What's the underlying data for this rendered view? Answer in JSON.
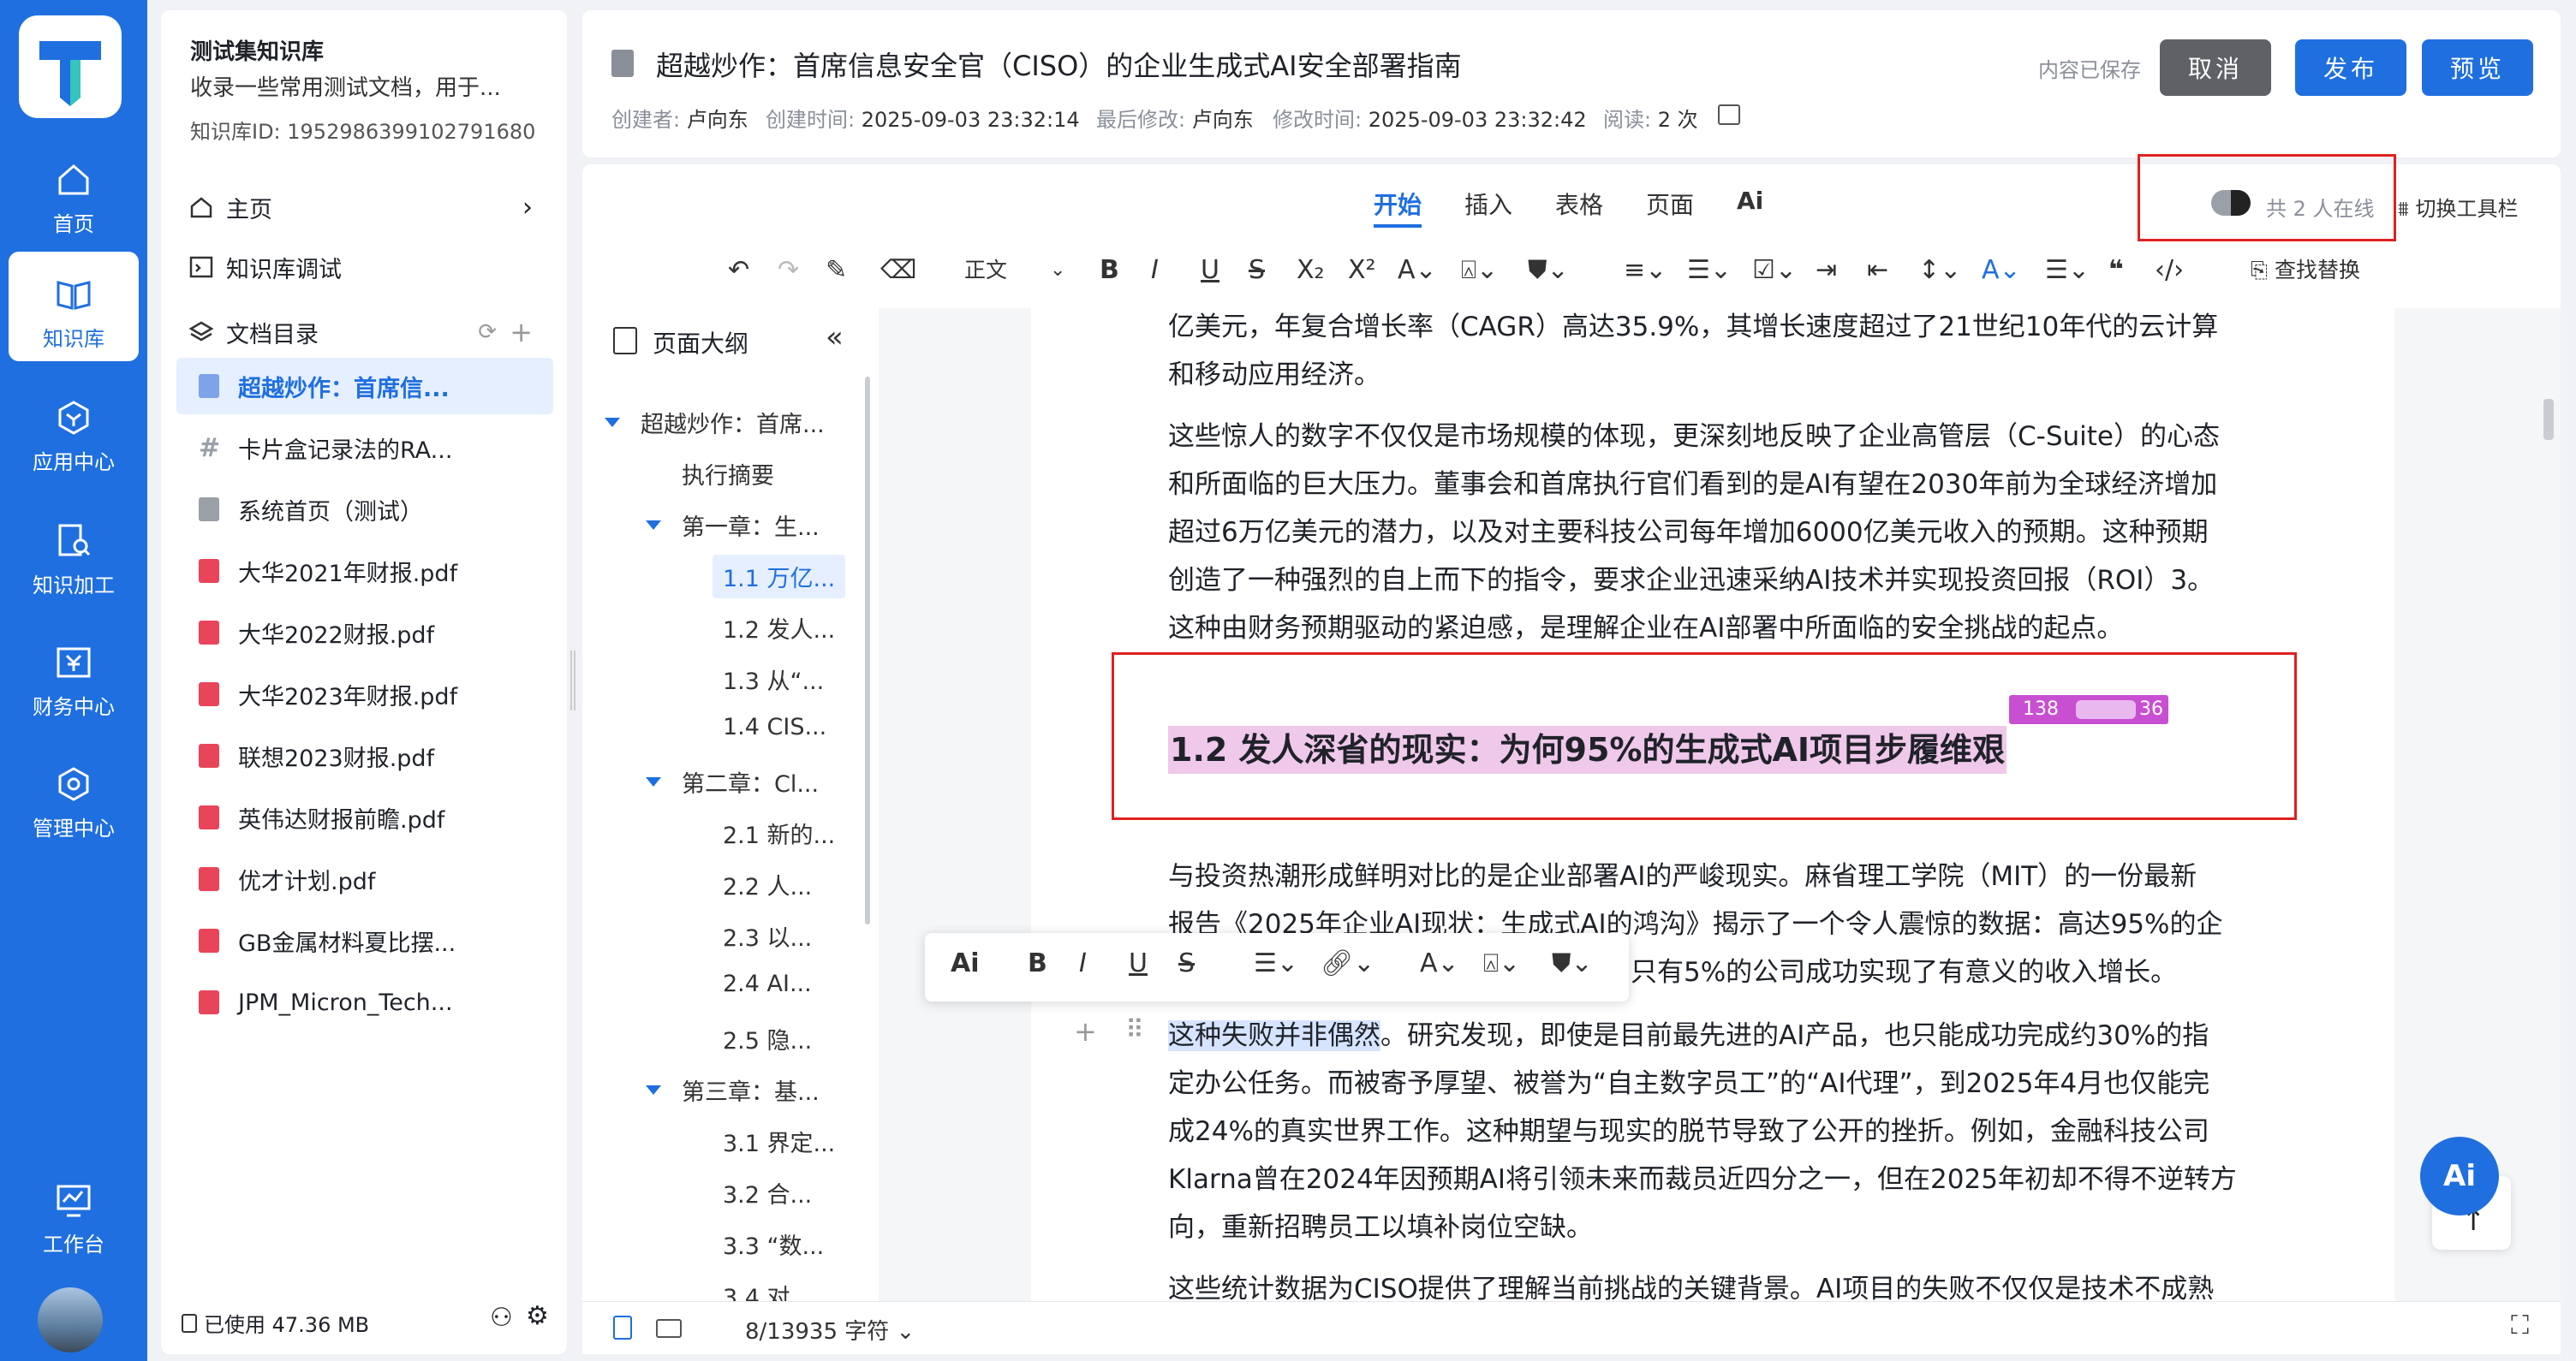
{
  "nav": {
    "items": [
      {
        "label": "首页",
        "icon": "home-icon"
      },
      {
        "label": "知识库",
        "icon": "book-icon"
      },
      {
        "label": "应用中心",
        "icon": "hexagon-icon"
      },
      {
        "label": "知识加工",
        "icon": "doc-search-icon"
      },
      {
        "label": "财务中心",
        "icon": "finance-icon"
      },
      {
        "label": "管理中心",
        "icon": "settings-hex-icon"
      },
      {
        "label": "工作台",
        "icon": "monitor-icon"
      }
    ]
  },
  "sidebar": {
    "title": "测试集知识库",
    "desc": "收录一些常用测试文档，用于...",
    "kb_id": "知识库ID: 1952986399102791680",
    "home": "主页",
    "debug": "知识库调试",
    "catalog": "文档目录",
    "docs": [
      {
        "label": "超越炒作：首席信...",
        "type": "note"
      },
      {
        "label": "卡片盒记录法的RA...",
        "type": "hash"
      },
      {
        "label": "系统首页（测试）",
        "type": "note"
      },
      {
        "label": "大华2021年财报.pdf",
        "type": "pdf"
      },
      {
        "label": "大华2022财报.pdf",
        "type": "pdf"
      },
      {
        "label": "大华2023年财报.pdf",
        "type": "pdf"
      },
      {
        "label": "联想2023财报.pdf",
        "type": "pdf"
      },
      {
        "label": "英伟达财报前瞻.pdf",
        "type": "pdf"
      },
      {
        "label": "优才计划.pdf",
        "type": "pdf"
      },
      {
        "label": "GB金属材料夏比摆...",
        "type": "pdf"
      },
      {
        "label": "JPM_Micron_Tech...",
        "type": "pdf"
      }
    ],
    "storage": "已使用 47.36 MB"
  },
  "header": {
    "title": "超越炒作：首席信息安全官（CISO）的企业生成式AI安全部署指南",
    "creator_label": "创建者:",
    "creator": "卢向东",
    "created_label": "创建时间:",
    "created": "2025-09-03 23:32:14",
    "modifier_label": "最后修改:",
    "modifier": "卢向东",
    "modified_label": "修改时间:",
    "modified": "2025-09-03 23:32:42",
    "reads_label": "阅读:",
    "reads": "2 次",
    "saved": "内容已保存",
    "cancel": "取消",
    "publish": "发布",
    "preview": "预览",
    "colors": {
      "cancel": "#5f6166",
      "primary": "#1f6fe0"
    }
  },
  "toolbar": {
    "tabs": [
      "开始",
      "插入",
      "表格",
      "页面",
      "Ai"
    ],
    "online": "共 2 人在线",
    "switch": "切换工具栏",
    "style": "正文",
    "find_replace": "查找替换"
  },
  "outline": {
    "title": "页面大纲",
    "items": [
      {
        "label": "超越炒作：首席...",
        "level": 0
      },
      {
        "label": "执行摘要",
        "level": 1
      },
      {
        "label": "第一章：生...",
        "level": 1
      },
      {
        "label": "1.1 万亿...",
        "level": 2,
        "active": true
      },
      {
        "label": "1.2 发人...",
        "level": 2
      },
      {
        "label": "1.3 从“...",
        "level": 2
      },
      {
        "label": "1.4 CIS...",
        "level": 2
      },
      {
        "label": "第二章：Cl...",
        "level": 1
      },
      {
        "label": "2.1 新的...",
        "level": 2
      },
      {
        "label": "2.2 人...",
        "level": 2
      },
      {
        "label": "2.3 以...",
        "level": 2
      },
      {
        "label": "2.4 AI...",
        "level": 2
      },
      {
        "label": "2.5 隐...",
        "level": 2
      },
      {
        "label": "第三章：基...",
        "level": 1
      },
      {
        "label": "3.1 界定...",
        "level": 2
      },
      {
        "label": "3.2 合...",
        "level": 2
      },
      {
        "label": "3.3 “数...",
        "level": 2
      },
      {
        "label": "3.4 对...",
        "level": 2
      }
    ]
  },
  "editor": {
    "p1": [
      "亿美元，年复合增长率（CAGR）高达35.9%，其增长速度超过了21世纪10年代的云计算",
      "和移动应用经济。"
    ],
    "p2": [
      "这些惊人的数字不仅仅是市场规模的体现，更深刻地反映了企业高管层（C-Suite）的心态",
      "和所面临的巨大压力。董事会和首席执行官们看到的是AI有望在2030年前为全球经济增加",
      "超过6万亿美元的潜力，以及对主要科技公司每年增加6000亿美元收入的预期。这种预期",
      "创造了一种强烈的自上而下的指令，要求企业迅速采纳AI技术并实现投资回报（ROI）3。",
      "这种由财务预期驱动的紧迫感，是理解企业在AI部署中所面临的安全挑战的起点。"
    ],
    "heading": "1.2 发人深省的现实：为何95%的生成式AI项目步履维艰",
    "user_tag_prefix": "138",
    "user_tag_suffix": "36",
    "p3": [
      "与投资热潮形成鲜明对比的是企业部署AI的严峻现实。麻省理工学院（MIT）的一份最新",
      "报告《2025年企业AI现状：生成式AI的鸿沟》揭示了一个令人震惊的数据：高达95%的企",
      "只有5%的公司成功实现了有意义的收入增长。"
    ],
    "p4_sel": "这种失败并非偶然",
    "p4_first": "。研究发现，即使是目前最先进的AI产品，也只能成功完成约30%的指",
    "p4": [
      "定办公任务。而被寄予厚望、被誉为“自主数字员工”的“AI代理”，到2025年4月也仅能完",
      "成24%的真实世界工作。这种期望与现实的脱节导致了公开的挫折。例如，金融科技公司",
      "Klarna曾在2024年因预期AI将引领未来而裁员近四分之一，但在2025年初却不得不逆转方",
      "向，重新招聘员工以填补岗位空缺。"
    ],
    "p5": "这些统计数据为CISO提供了理解当前挑战的关键背景。AI项目的失败不仅仅是技术不成熟",
    "char_count": "8/13935 字符",
    "ai_label": "Ai"
  }
}
